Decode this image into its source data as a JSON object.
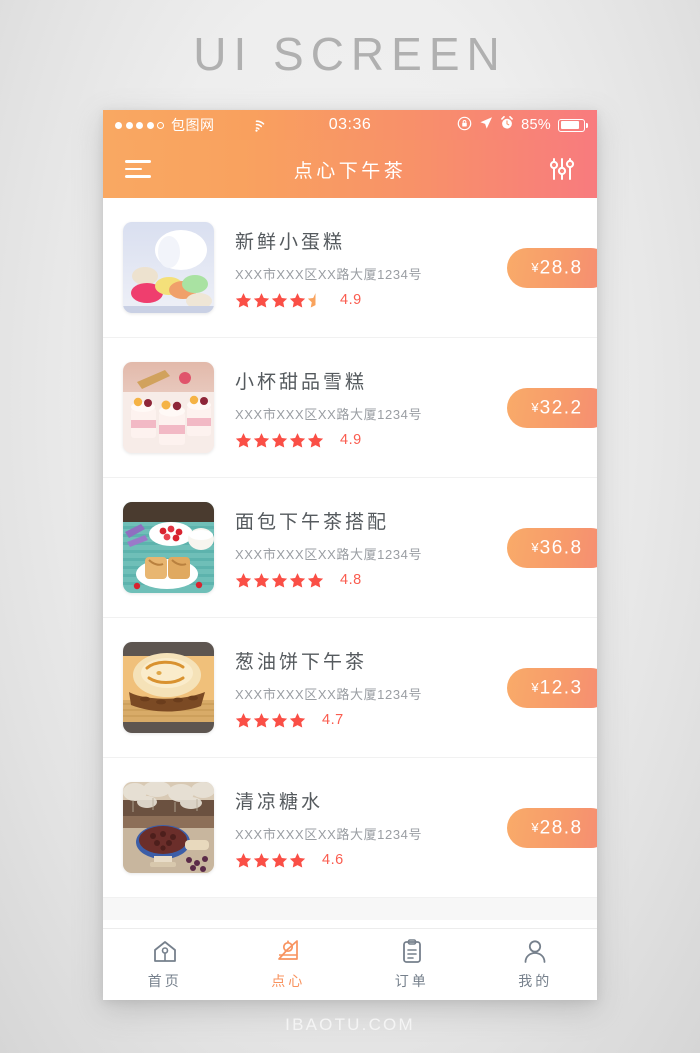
{
  "page": {
    "heading": "UI SCREEN",
    "footer_url": "IBAOTU.COM",
    "accent_orange": "#f8935f",
    "accent_red": "#fa5c4f",
    "nav_gradient_from": "#f9a862",
    "nav_gradient_to": "#f87b7e"
  },
  "statusbar": {
    "carrier": "包图网",
    "time": "03:36",
    "battery_percent": "85%",
    "signal_dots_filled": 4,
    "signal_dots_total": 5,
    "icons": [
      "wifi-icon",
      "rotation-lock-icon",
      "location-arrow-icon",
      "alarm-clock-icon",
      "battery-icon"
    ]
  },
  "navbar": {
    "menu_icon": "hamburger-menu-icon",
    "title": "点心下午茶",
    "filter_icon": "sliders-filter-icon"
  },
  "list": {
    "items": [
      {
        "name": "新鲜小蛋糕",
        "address": "XXX市XXX区XX路大厦1234号",
        "stars_full": 4,
        "stars_half": 1,
        "score": "4.9",
        "price": "28.8",
        "currency": "¥",
        "thumb": "macaron-cups-photo"
      },
      {
        "name": "小杯甜品雪糕",
        "address": "XXX市XXX区XX路大厦1234号",
        "stars_full": 5,
        "stars_half": 0,
        "score": "4.9",
        "price": "32.2",
        "currency": "¥",
        "thumb": "parfait-cups-photo"
      },
      {
        "name": "面包下午茶搭配",
        "address": "XXX市XXX区XX路大厦1234号",
        "stars_full": 5,
        "stars_half": 0,
        "score": "4.8",
        "price": "36.8",
        "currency": "¥",
        "thumb": "bread-berries-photo"
      },
      {
        "name": "葱油饼下午茶",
        "address": "XXX市XXX区XX路大厦1234号",
        "stars_full": 4,
        "stars_half": 0,
        "score": "4.7",
        "price": "12.3",
        "currency": "¥",
        "thumb": "scallion-pancake-photo"
      },
      {
        "name": "清凉糖水",
        "address": "XXX市XXX区XX路大厦1234号",
        "stars_full": 4,
        "stars_half": 0,
        "score": "4.6",
        "price": "28.8",
        "currency": "¥",
        "thumb": "sweet-soup-bowl-photo"
      }
    ]
  },
  "tabbar": {
    "tabs": [
      {
        "label": "首页",
        "icon": "home-icon",
        "active": false
      },
      {
        "label": "点心",
        "icon": "dessert-icon",
        "active": true
      },
      {
        "label": "订单",
        "icon": "clipboard-order-icon",
        "active": false
      },
      {
        "label": "我的",
        "icon": "user-profile-icon",
        "active": false
      }
    ]
  }
}
